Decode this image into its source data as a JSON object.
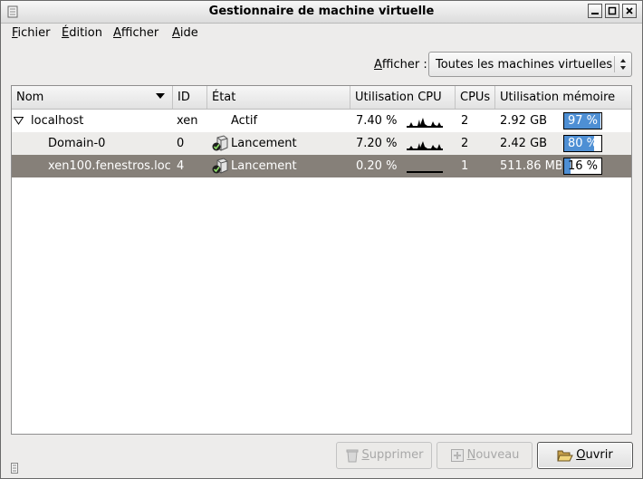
{
  "window": {
    "title": "Gestionnaire de machine virtuelle"
  },
  "menubar": {
    "items": [
      {
        "label": "Fichier",
        "accel": "F",
        "rest": "ichier"
      },
      {
        "label": "Édition",
        "accel": "É",
        "rest": "dition"
      },
      {
        "label": "Afficher",
        "accel": "A",
        "rest": "fficher"
      },
      {
        "label": "Aide",
        "accel": "A",
        "rest": "ide"
      }
    ]
  },
  "filter": {
    "label_accel": "A",
    "label_rest": "fficher :",
    "value": "Toutes les machines virtuelles"
  },
  "table": {
    "columns": [
      "Nom",
      "ID",
      "État",
      "Utilisation CPU",
      "CPUs",
      "Utilisation mémoire"
    ],
    "rows": [
      {
        "name": "localhost",
        "id": "xen",
        "state": "Actif",
        "cpu": "7.40 %",
        "cpus": "2",
        "mem": "2.92 GB",
        "mem_pct": "97 %",
        "mem_fraction": 0.97
      },
      {
        "name": "Domain-0",
        "id": "0",
        "state": "Lancement",
        "cpu": "7.20 %",
        "cpus": "2",
        "mem": "2.42 GB",
        "mem_pct": "80 %",
        "mem_fraction": 0.8
      },
      {
        "name": "xen100.fenestros.loc",
        "id": "4",
        "state": "Lancement",
        "cpu": "0.20 %",
        "cpus": "1",
        "mem": "511.86 MB",
        "mem_pct": "16 %",
        "mem_fraction": 0.16
      }
    ]
  },
  "buttons": {
    "delete": {
      "accel": "S",
      "rest": "upprimer"
    },
    "new": {
      "accel": "N",
      "rest": "ouveau"
    },
    "open": {
      "accel": "O",
      "rest": "uvrir"
    }
  },
  "colors": {
    "selection": "#868079",
    "memory_bar": "#4e8fd4"
  },
  "icons": [
    "window-menu-icon",
    "minimize-icon",
    "maximize-icon",
    "close-icon",
    "combo-arrows-icon",
    "sort-descending-icon",
    "expander-icon",
    "running-vm-icon",
    "trash-icon",
    "new-vm-icon",
    "folder-open-icon",
    "resize-grip-icon"
  ]
}
